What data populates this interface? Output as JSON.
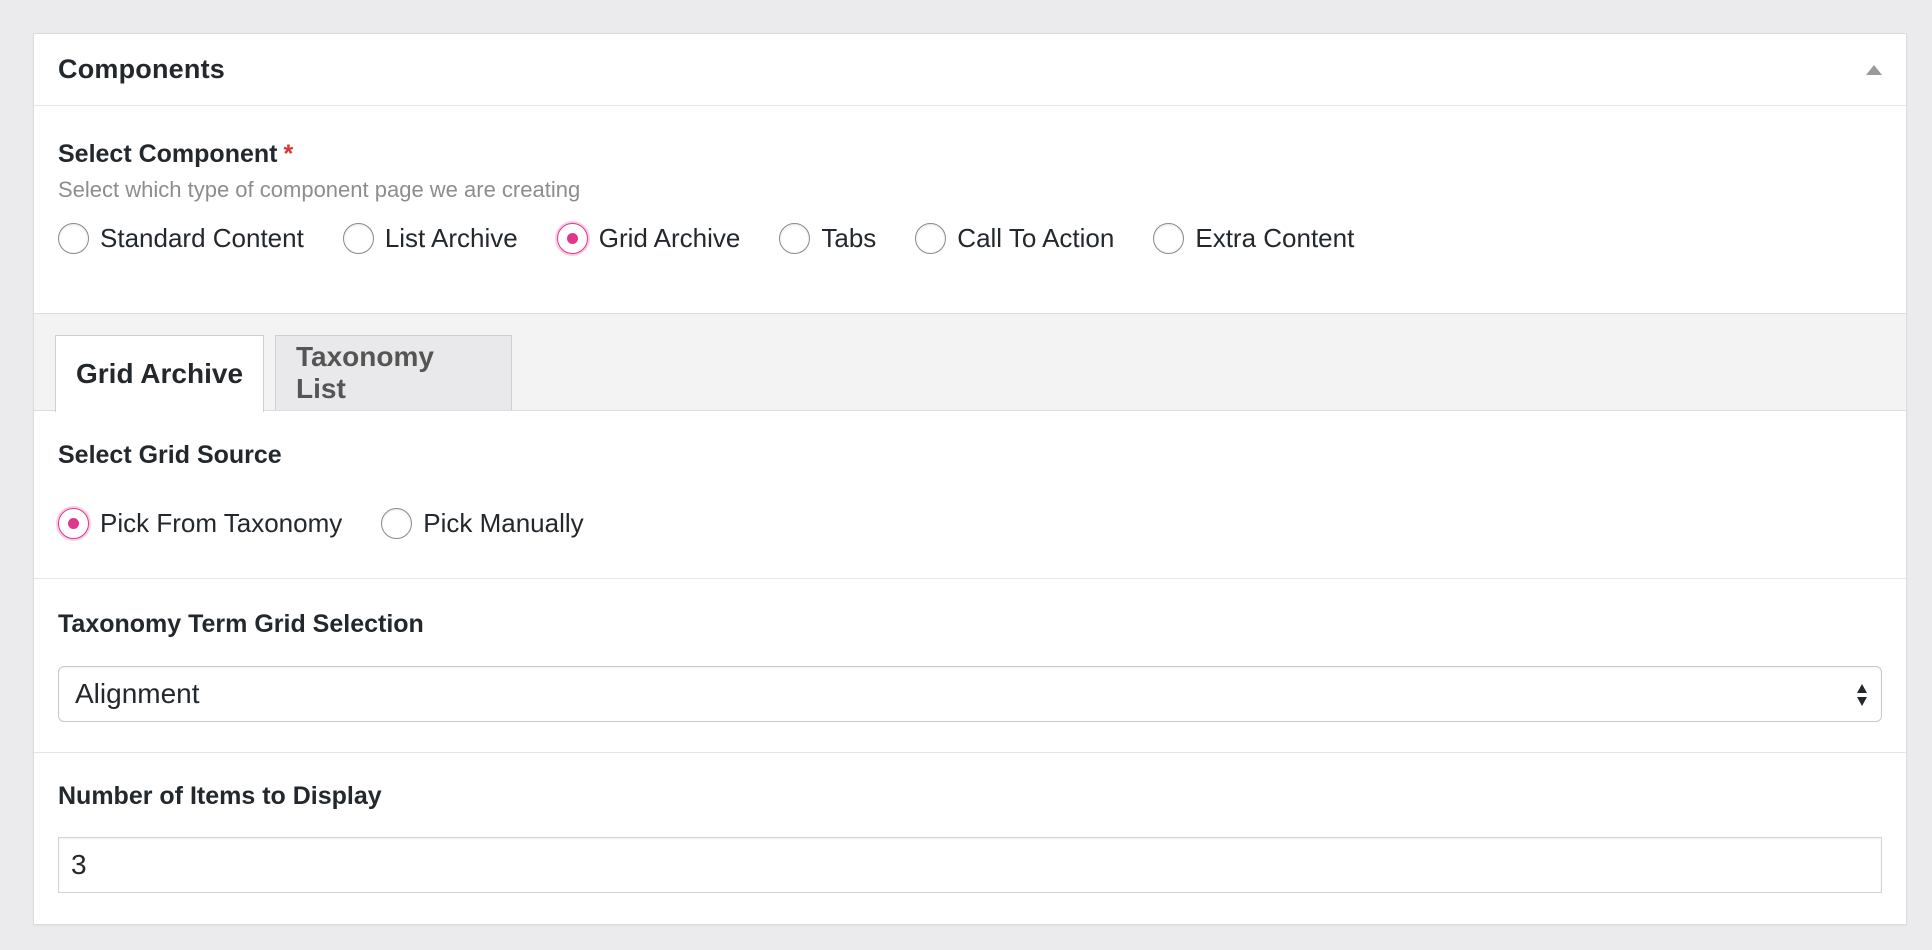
{
  "panel": {
    "title": "Components"
  },
  "component_field": {
    "label": "Select Component",
    "required_marker": "*",
    "description": "Select which type of component page we are creating",
    "options": [
      {
        "label": "Standard Content",
        "checked": false
      },
      {
        "label": "List Archive",
        "checked": false
      },
      {
        "label": "Grid Archive",
        "checked": true
      },
      {
        "label": "Tabs",
        "checked": false
      },
      {
        "label": "Call To Action",
        "checked": false
      },
      {
        "label": "Extra Content",
        "checked": false
      }
    ]
  },
  "tabs": [
    {
      "label": "Grid Archive",
      "active": true
    },
    {
      "label": "Taxonomy List",
      "active": false
    }
  ],
  "grid_source_field": {
    "label": "Select Grid Source",
    "options": [
      {
        "label": "Pick From Taxonomy",
        "checked": true
      },
      {
        "label": "Pick Manually",
        "checked": false
      }
    ]
  },
  "taxonomy_field": {
    "label": "Taxonomy Term Grid Selection",
    "selected_value": "Alignment"
  },
  "items_field": {
    "label": "Number of Items to Display",
    "value": "3"
  },
  "colors": {
    "accent": "#e0378e",
    "required": "#dc3232",
    "background": "#ebeaed"
  },
  "icons": {
    "collapse": "triangle-up-icon",
    "select_arrows": "up-down-arrows-icon"
  }
}
